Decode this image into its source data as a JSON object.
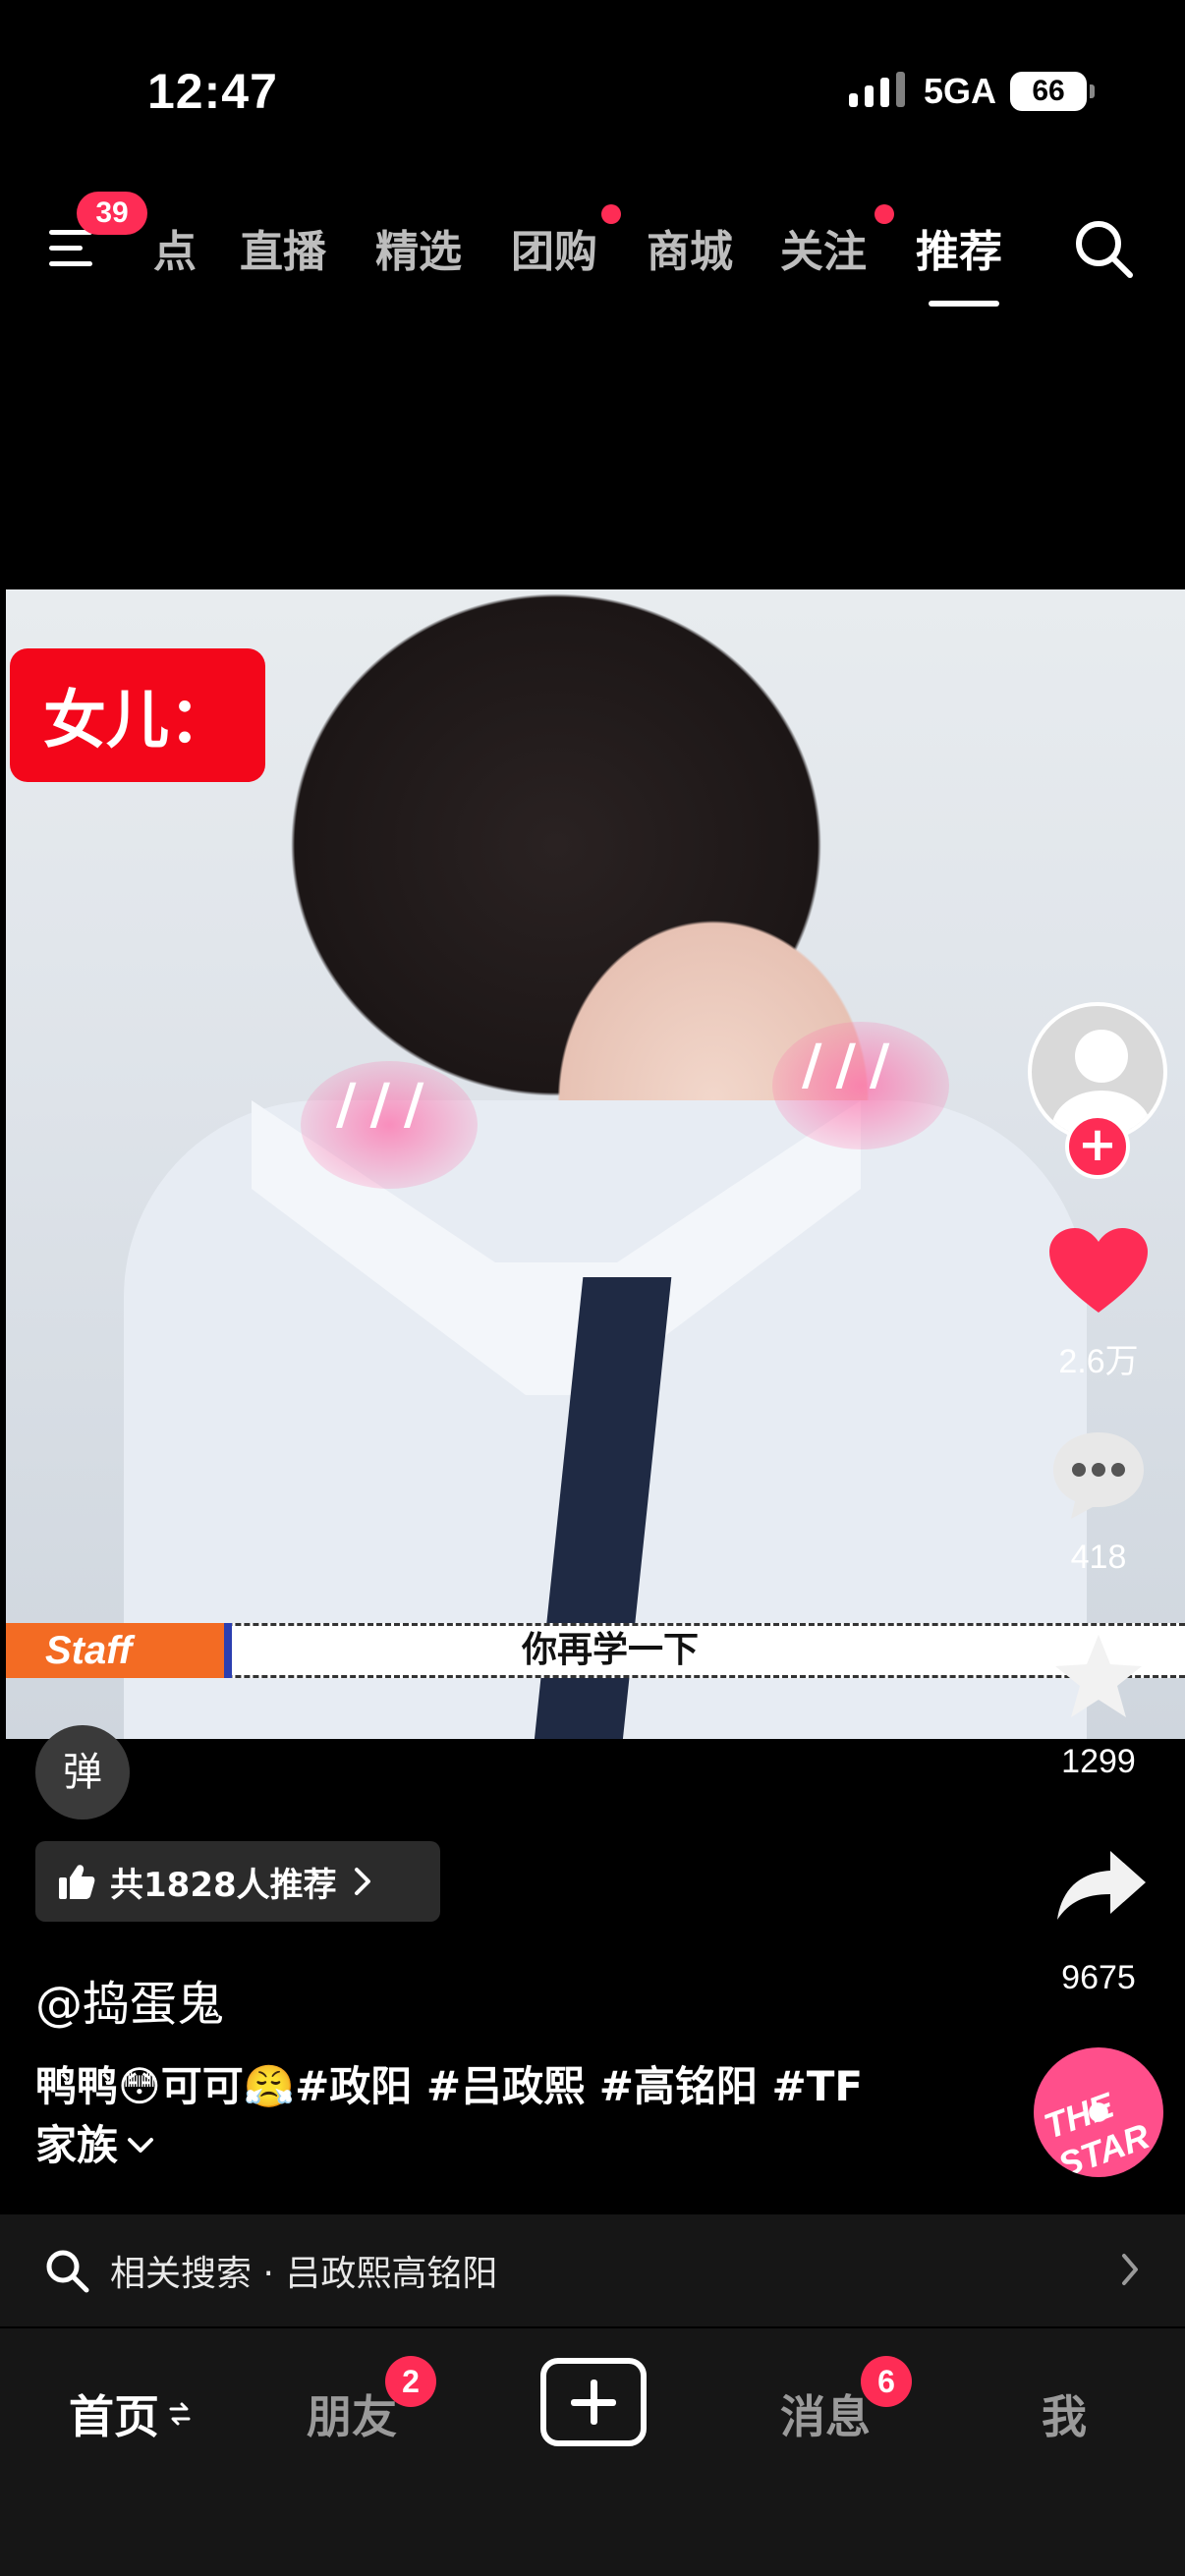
{
  "status_bar": {
    "time": "12:47",
    "network": "5GA",
    "battery": "66"
  },
  "top_nav": {
    "menu_badge": "39",
    "tabs": [
      {
        "label": "点",
        "active": false
      },
      {
        "label": "直播",
        "active": false
      },
      {
        "label": "精选",
        "active": false
      },
      {
        "label": "团购",
        "active": false,
        "dot": true
      },
      {
        "label": "商城",
        "active": false
      },
      {
        "label": "关注",
        "active": false,
        "dot": true
      },
      {
        "label": "推荐",
        "active": true
      }
    ]
  },
  "video": {
    "overlay_label": "女儿：",
    "staff_tag": "Staff",
    "caption": "你再学一下",
    "blush_marks": "///"
  },
  "right_rail": {
    "likes": "2.6万",
    "comments": "418",
    "favorites": "1299",
    "shares": "9675",
    "music_disc_text": "THE STAR"
  },
  "danmu_label": "弹",
  "recommend": {
    "text": "共1828人推荐"
  },
  "post": {
    "author": "@捣蛋鬼",
    "description_line1": "鸭鸭😳可可😤#政阳 #吕政熙 #高铭阳 #TF",
    "description_line2": "家族"
  },
  "related_search": {
    "text": "相关搜索 · 吕政熙高铭阳"
  },
  "bottom_nav": {
    "home": "首页",
    "friends": "朋友",
    "friends_badge": "2",
    "messages": "消息",
    "messages_badge": "6",
    "me": "我"
  },
  "colors": {
    "accent": "#fe2c55",
    "background": "#000000",
    "nav_bg": "#161616"
  }
}
